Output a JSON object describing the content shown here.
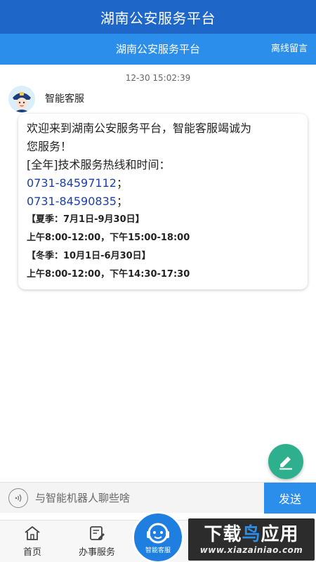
{
  "header": {
    "title": "湖南公安服务平台"
  },
  "subheader": {
    "title": "湖南公安服务平台",
    "offline_label": "离线留言"
  },
  "chat": {
    "timestamp": "12-30 15:02:39",
    "bot_name": "智能客服",
    "message": {
      "line1": "欢迎来到湖南公安服务平台，智能客服竭诚为",
      "line2": "您服务！",
      "line3": "[全年]技术服务热线和时间：",
      "phone1": "0731-84597112",
      "phone1_tail": "；",
      "phone2": "0731-84590835",
      "phone2_tail": "；",
      "summer_label": "【夏季：7月1日-9月30日】",
      "summer_hours": "上午8:00-12:00，下午15:00-18:00",
      "winter_label": "【冬季：10月1日-6月30日】",
      "winter_hours": "上午8:00-12:00，下午14:30-17:30"
    }
  },
  "input": {
    "placeholder": "与智能机器人聊些啥",
    "send_label": "发送"
  },
  "tabbar": {
    "tabs": [
      {
        "label": "首页",
        "icon": "home-icon"
      },
      {
        "label": "办事服务",
        "icon": "service-icon"
      }
    ],
    "center_label": "智能客服"
  },
  "watermark": {
    "big": "下载鸟应用",
    "small": "www.xiazainiao.com"
  },
  "colors": {
    "header": "#1e67c8",
    "subheader": "#2a8eea",
    "send": "#2a8eea",
    "fab": "#2eb08f",
    "phone": "#1a3fa8"
  }
}
